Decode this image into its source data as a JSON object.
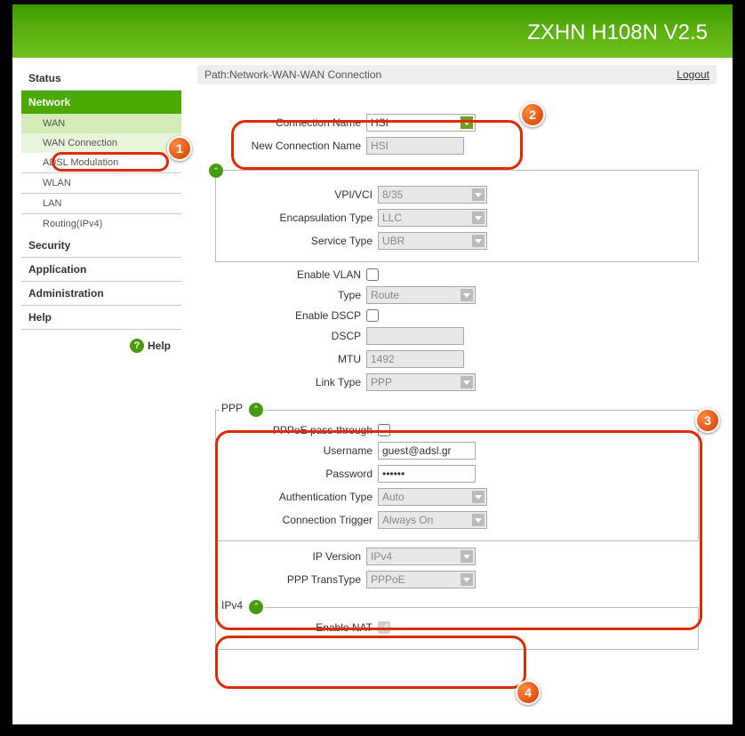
{
  "banner": {
    "title": "ZXHN H108N V2.5"
  },
  "sidebar": {
    "items": [
      "Status",
      "Network",
      "Security",
      "Application",
      "Administration",
      "Help"
    ],
    "network_sub": [
      "WAN",
      "WAN Connection",
      "ADSL Modulation",
      "WLAN",
      "LAN",
      "Routing(IPv4)"
    ],
    "help_label": "Help"
  },
  "breadcrumb": {
    "path": "Path:Network-WAN-WAN Connection",
    "logout": "Logout"
  },
  "form": {
    "conn_name_label": "Connection Name",
    "conn_name_value": "HSI",
    "new_conn_label": "New Connection Name",
    "new_conn_value": "HSI",
    "vpi_label": "VPI/VCI",
    "vpi_value": "8/35",
    "encap_label": "Encapsulation Type",
    "encap_value": "LLC",
    "service_label": "Service Type",
    "service_value": "UBR",
    "enable_vlan_label": "Enable VLAN",
    "type_label": "Type",
    "type_value": "Route",
    "enable_dscp_label": "Enable DSCP",
    "dscp_label": "DSCP",
    "dscp_value": "",
    "mtu_label": "MTU",
    "mtu_value": "1492",
    "link_type_label": "Link Type",
    "link_type_value": "PPP",
    "ppp_header": "PPP",
    "pppoe_pass_label": "PPPoE pass-through",
    "username_label": "Username",
    "username_value": "guest@adsl.gr",
    "password_label": "Password",
    "password_value": "••••••",
    "auth_label": "Authentication Type",
    "auth_value": "Auto",
    "trigger_label": "Connection Trigger",
    "trigger_value": "Always On",
    "ipver_label": "IP Version",
    "ipver_value": "IPv4",
    "ppptrans_label": "PPP TransType",
    "ppptrans_value": "PPPoE",
    "ipv4_header": "IPv4",
    "enable_nat_label": "Enable NAT"
  },
  "annot": {
    "a1": "1",
    "a2": "2",
    "a3": "3",
    "a4": "4"
  }
}
